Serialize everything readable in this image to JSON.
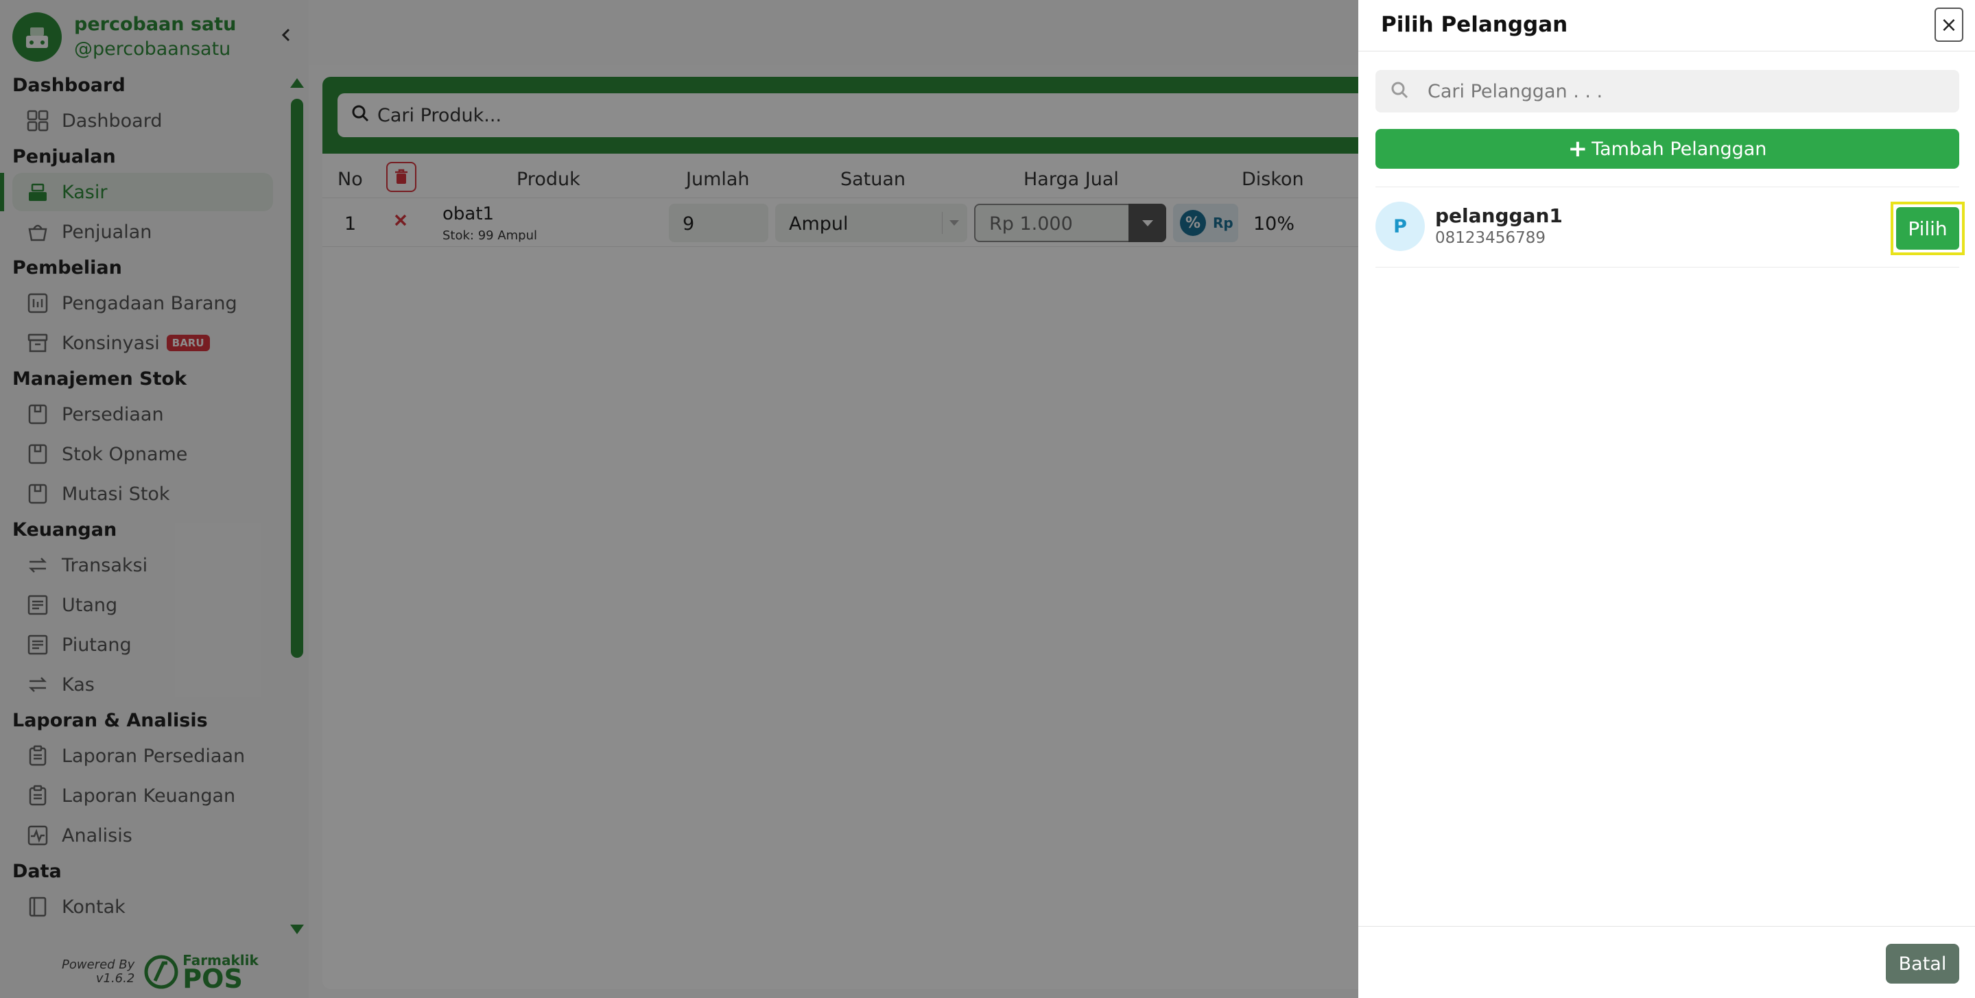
{
  "brand": {
    "name": "percobaan satu",
    "handle": "@percobaansatu"
  },
  "sidebar": {
    "sections": [
      {
        "title": "Dashboard",
        "items": [
          {
            "label": "Dashboard",
            "icon": "grid-icon"
          }
        ]
      },
      {
        "title": "Penjualan",
        "items": [
          {
            "label": "Kasir",
            "icon": "cashier-icon",
            "active": true
          },
          {
            "label": "Penjualan",
            "icon": "basket-icon"
          }
        ]
      },
      {
        "title": "Pembelian",
        "items": [
          {
            "label": "Pengadaan Barang",
            "icon": "procurement-icon"
          },
          {
            "label": "Konsinyasi",
            "icon": "archive-icon",
            "badge": "BARU"
          }
        ]
      },
      {
        "title": "Manajemen Stok",
        "items": [
          {
            "label": "Persediaan",
            "icon": "box-icon"
          },
          {
            "label": "Stok Opname",
            "icon": "box-icon"
          },
          {
            "label": "Mutasi Stok",
            "icon": "box-icon"
          }
        ]
      },
      {
        "title": "Keuangan",
        "items": [
          {
            "label": "Transaksi",
            "icon": "transfer-icon"
          },
          {
            "label": "Utang",
            "icon": "list-icon"
          },
          {
            "label": "Piutang",
            "icon": "list-icon"
          },
          {
            "label": "Kas",
            "icon": "transfer-icon"
          }
        ]
      },
      {
        "title": "Laporan & Analisis",
        "items": [
          {
            "label": "Laporan Persediaan",
            "icon": "clipboard-icon"
          },
          {
            "label": "Laporan Keuangan",
            "icon": "clipboard-icon"
          },
          {
            "label": "Analisis",
            "icon": "pulse-icon"
          }
        ]
      },
      {
        "title": "Data",
        "items": [
          {
            "label": "Kontak",
            "icon": "contact-book-icon"
          }
        ]
      }
    ],
    "powered_by": "Powered By",
    "version": "v1.6.2",
    "powered_brand": "Farmaklik",
    "powered_pos": "POS"
  },
  "main": {
    "product_search_placeholder": "Cari Produk...",
    "columns": {
      "no": "No",
      "produk": "Produk",
      "jumlah": "Jumlah",
      "satuan": "Satuan",
      "harga_jual": "Harga Jual",
      "diskon": "Diskon"
    },
    "rows": [
      {
        "no": "1",
        "name": "obat1",
        "stock": "Stok: 99 Ampul",
        "qty": "9",
        "unit": "Ampul",
        "price": "Rp 1.000",
        "disc_pct": "%",
        "disc_rp": "Rp",
        "discount": "10%"
      }
    ]
  },
  "drawer": {
    "title": "Pilih Pelanggan",
    "close": "×",
    "search_placeholder": "Cari Pelanggan . . .",
    "add_label": "Tambah Pelanggan",
    "customers": [
      {
        "initial": "P",
        "name": "pelanggan1",
        "phone": "08123456789",
        "action": "Pilih"
      }
    ],
    "cancel_label": "Batal"
  },
  "colors": {
    "brand_green": "#2e8b3a",
    "button_green": "#2ea84a",
    "highlight": "#e8e21b",
    "cancel": "#5e7466",
    "danger": "#d9363e"
  }
}
